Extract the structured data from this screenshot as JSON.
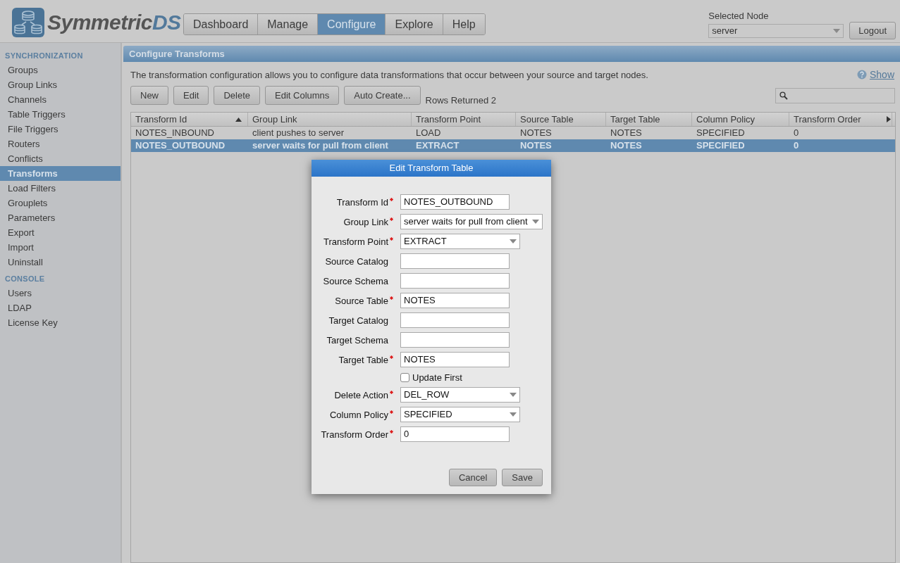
{
  "logo": {
    "main": "Symmetric",
    "accent": "DS"
  },
  "nav": [
    {
      "label": "Dashboard",
      "selected": false
    },
    {
      "label": "Manage",
      "selected": false
    },
    {
      "label": "Configure",
      "selected": true
    },
    {
      "label": "Explore",
      "selected": false
    },
    {
      "label": "Help",
      "selected": false
    }
  ],
  "node": {
    "label": "Selected Node",
    "value": "server",
    "logout": "Logout"
  },
  "sidebar": [
    {
      "title": "SYNCHRONIZATION",
      "items": [
        {
          "label": "Groups",
          "selected": false
        },
        {
          "label": "Group Links",
          "selected": false
        },
        {
          "label": "Channels",
          "selected": false
        },
        {
          "label": "Table Triggers",
          "selected": false
        },
        {
          "label": "File Triggers",
          "selected": false
        },
        {
          "label": "Routers",
          "selected": false
        },
        {
          "label": "Conflicts",
          "selected": false
        },
        {
          "label": "Transforms",
          "selected": true
        },
        {
          "label": "Load Filters",
          "selected": false
        },
        {
          "label": "Grouplets",
          "selected": false
        },
        {
          "label": "Parameters",
          "selected": false
        },
        {
          "label": "Export",
          "selected": false
        },
        {
          "label": "Import",
          "selected": false
        },
        {
          "label": "Uninstall",
          "selected": false
        }
      ]
    },
    {
      "title": "CONSOLE",
      "items": [
        {
          "label": "Users",
          "selected": false
        },
        {
          "label": "LDAP",
          "selected": false
        },
        {
          "label": "License Key",
          "selected": false
        }
      ]
    }
  ],
  "panel": {
    "title": "Configure Transforms",
    "description": "The transformation configuration allows you to configure data transformations that occur between your source and target nodes.",
    "help_link": "Show",
    "buttons": [
      "New",
      "Edit",
      "Delete",
      "Edit Columns",
      "Auto Create..."
    ],
    "rows_returned": "Rows Returned 2"
  },
  "table": {
    "columns": [
      {
        "label": "Transform Id",
        "sorted": true
      },
      {
        "label": "Group Link",
        "sorted": false
      },
      {
        "label": "Transform Point",
        "sorted": false
      },
      {
        "label": "Source Table",
        "sorted": false
      },
      {
        "label": "Target Table",
        "sorted": false
      },
      {
        "label": "Column Policy",
        "sorted": false
      },
      {
        "label": "Transform Order",
        "sorted": false
      }
    ],
    "rows": [
      {
        "cells": [
          "NOTES_INBOUND",
          "client pushes to server",
          "LOAD",
          "NOTES",
          "NOTES",
          "SPECIFIED",
          "0"
        ],
        "selected": false
      },
      {
        "cells": [
          "NOTES_OUTBOUND",
          "server waits for pull from client",
          "EXTRACT",
          "NOTES",
          "NOTES",
          "SPECIFIED",
          "0"
        ],
        "selected": true
      }
    ]
  },
  "dialog": {
    "title": "Edit Transform Table",
    "fields": [
      {
        "kind": "text",
        "label": "Transform Id",
        "required": true,
        "value": "NOTES_OUTBOUND"
      },
      {
        "kind": "select",
        "label": "Group Link",
        "required": true,
        "value": "server waits for pull from client"
      },
      {
        "kind": "select",
        "label": "Transform Point",
        "required": true,
        "value": "EXTRACT"
      },
      {
        "kind": "text",
        "label": "Source Catalog",
        "required": false
      },
      {
        "kind": "text",
        "label": "Source Schema",
        "required": false
      },
      {
        "kind": "text",
        "label": "Source Table",
        "required": true,
        "value": "NOTES"
      },
      {
        "kind": "text",
        "label": "Target Catalog",
        "required": false
      },
      {
        "kind": "text",
        "label": "Target Schema",
        "required": false
      },
      {
        "kind": "text",
        "label": "Target Table",
        "required": true,
        "value": "NOTES"
      },
      {
        "kind": "checkbox",
        "label": "Update First",
        "checked": false
      },
      {
        "kind": "select",
        "label": "Delete Action",
        "required": true,
        "value": "DEL_ROW"
      },
      {
        "kind": "select",
        "label": "Column Policy",
        "required": true,
        "value": "SPECIFIED"
      },
      {
        "kind": "text",
        "label": "Transform Order",
        "required": true,
        "value": "0"
      }
    ],
    "buttons": [
      "Cancel",
      "Save"
    ]
  }
}
